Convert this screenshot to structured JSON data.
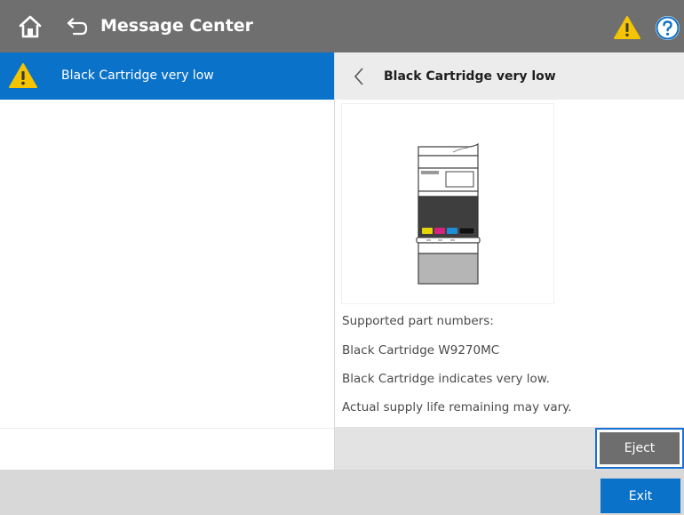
{
  "header": {
    "title": "Message Center",
    "icons": [
      "home-icon",
      "back-icon",
      "warning-icon",
      "help-icon"
    ],
    "background": "#6f6f6f"
  },
  "message_list": {
    "items": [
      {
        "label": "Black Cartridge very low",
        "icon": "warning-icon",
        "selected": true
      }
    ],
    "selected_color": "#0b72c9"
  },
  "detail": {
    "title": "Black Cartridge very low",
    "back_icon": "chevron-left-icon",
    "lines": [
      "Supported part numbers:",
      "Black Cartridge W9270MC",
      "Black Cartridge indicates very low.",
      "Actual supply life remaining may vary."
    ],
    "eject_label": "Eject"
  },
  "footer": {
    "exit_label": "Exit"
  },
  "colors": {
    "accent": "#0b72c9",
    "warning": "#f5c400"
  }
}
